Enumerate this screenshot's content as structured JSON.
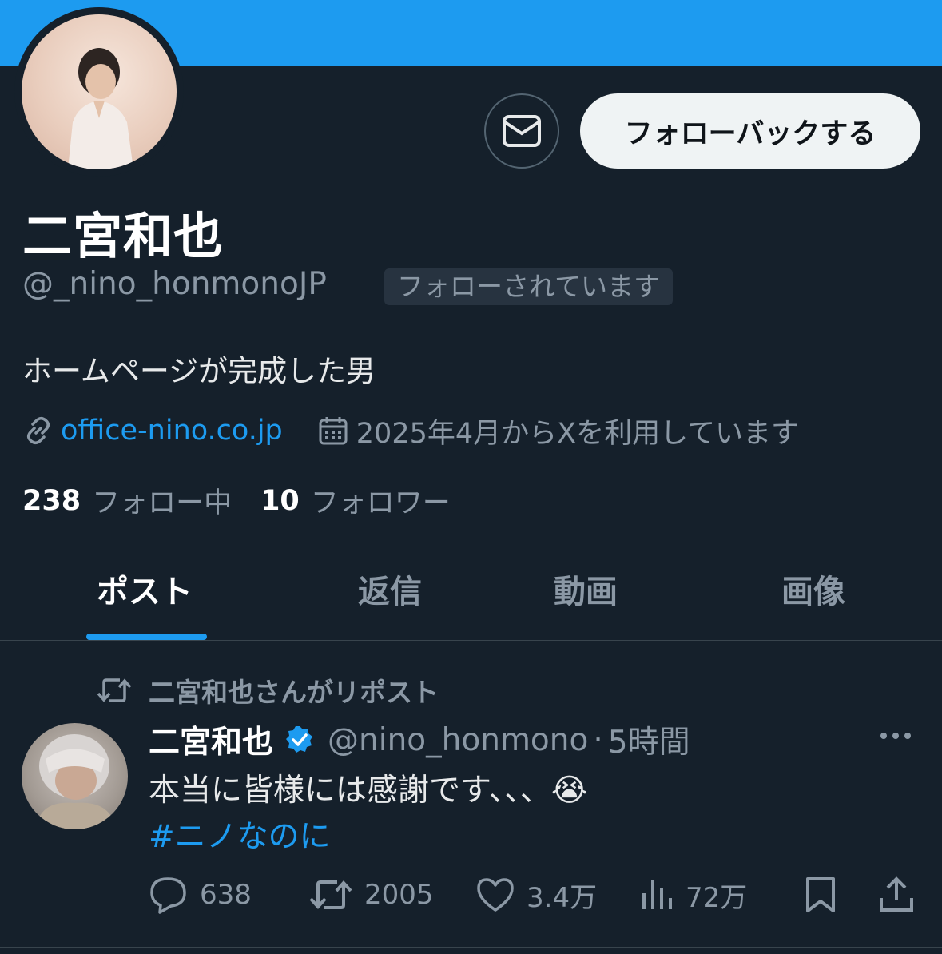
{
  "profile": {
    "name": "二宮和也",
    "handle": "@_nino_honmono​JP",
    "follows_you": "フォローされています",
    "bio": "ホームページが完成した男",
    "link": "office-nino.co.jp",
    "joined": "2025年4月からXを利用しています",
    "following_count": "238",
    "following_label": "フォロー中",
    "followers_count": "10",
    "followers_label": "フォロワー"
  },
  "buttons": {
    "follow_back": "フォローバックする"
  },
  "tabs": [
    {
      "label": "ポスト",
      "active": true
    },
    {
      "label": "返信",
      "active": false
    },
    {
      "label": "動画",
      "active": false
    },
    {
      "label": "画像",
      "active": false
    }
  ],
  "post": {
    "repost_note": "二宮和也さんがリポスト",
    "author_name": "二宮和也",
    "author_handle": "@nino_honmono",
    "time": "5時間",
    "text": "本当に皆様には感謝です、、、😭",
    "hashtag": "#ニノなのに",
    "replies": "638",
    "reposts": "2005",
    "likes": "3.4万",
    "views": "72万"
  },
  "colors": {
    "background": "#15202b",
    "accent": "#1d9bf0",
    "muted": "#8b98a5"
  },
  "icons": [
    "envelope-icon",
    "link-icon",
    "calendar-icon",
    "repost-icon",
    "verified-icon",
    "more-icon",
    "reply-icon",
    "like-icon",
    "views-icon",
    "bookmark-icon",
    "share-icon"
  ]
}
